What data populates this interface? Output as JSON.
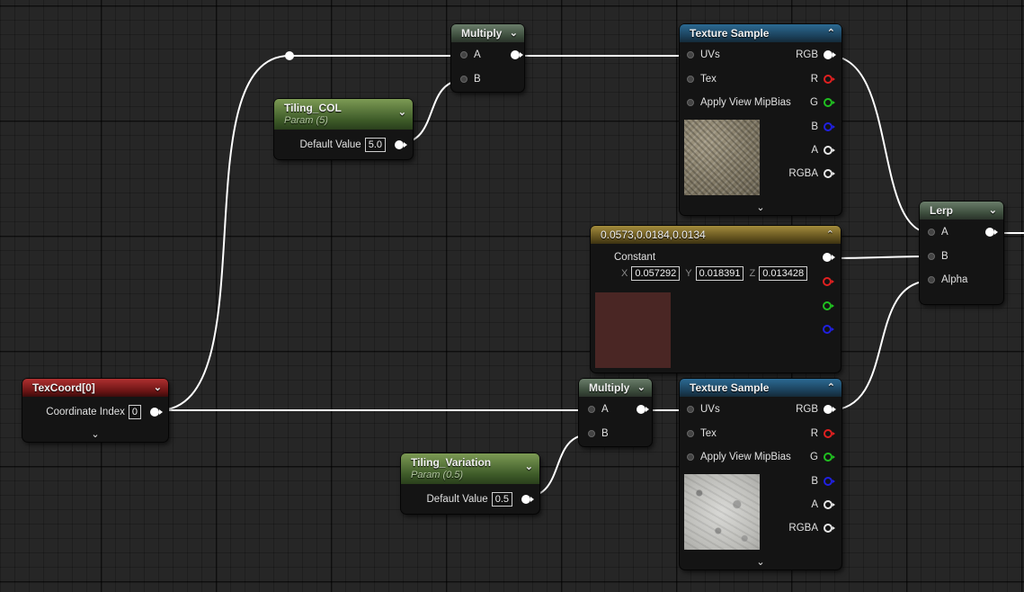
{
  "colors": {
    "constant_swatch": "#4a2624",
    "wire": "#ffffff"
  },
  "nodes": {
    "multiply_top": {
      "title": "Multiply",
      "in_a": "A",
      "in_b": "B"
    },
    "texsample_top": {
      "title": "Texture Sample",
      "in_uvs": "UVs",
      "in_tex": "Tex",
      "in_mip": "Apply View MipBias",
      "out_rgb": "RGB",
      "out_r": "R",
      "out_g": "G",
      "out_b": "B",
      "out_a": "A",
      "out_rgba": "RGBA"
    },
    "tiling_col": {
      "title": "Tiling_COL",
      "subtitle": "Param (5)",
      "label": "Default Value",
      "value": "5.0"
    },
    "lerp": {
      "title": "Lerp",
      "in_a": "A",
      "in_b": "B",
      "in_alpha": "Alpha"
    },
    "constant": {
      "title": "0.0573,0.0184,0.0134",
      "label": "Constant",
      "x_label": "X",
      "x": "0.057292",
      "y_label": "Y",
      "y": "0.018391",
      "z_label": "Z",
      "z": "0.013428"
    },
    "texcoord": {
      "title": "TexCoord[0]",
      "label": "Coordinate Index",
      "value": "0"
    },
    "multiply_bottom": {
      "title": "Multiply",
      "in_a": "A",
      "in_b": "B"
    },
    "tiling_variation": {
      "title": "Tiling_Variation",
      "subtitle": "Param (0.5)",
      "label": "Default Value",
      "value": "0.5"
    },
    "texsample_bottom": {
      "title": "Texture Sample",
      "in_uvs": "UVs",
      "in_tex": "Tex",
      "in_mip": "Apply View MipBias",
      "out_rgb": "RGB",
      "out_r": "R",
      "out_g": "G",
      "out_b": "B",
      "out_a": "A",
      "out_rgba": "RGBA"
    }
  },
  "icons": {
    "collapse": "chevron-down-icon",
    "expand": "chevron-up-icon"
  }
}
